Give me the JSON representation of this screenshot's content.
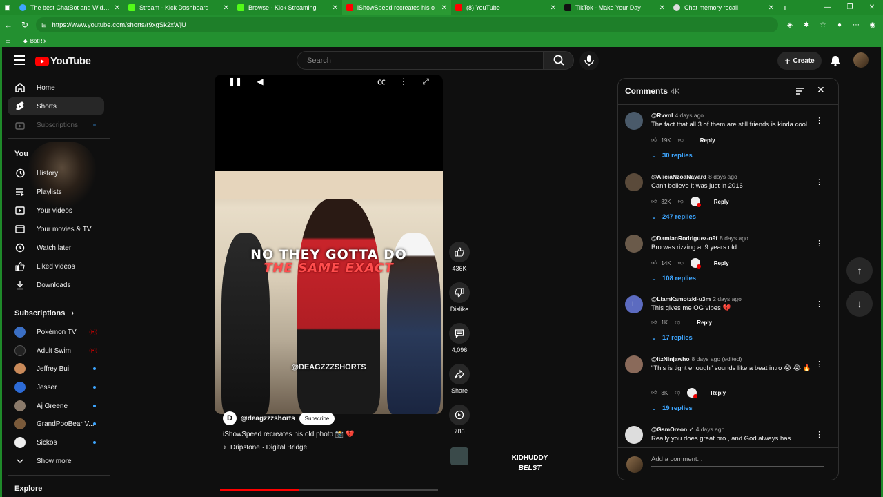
{
  "browser": {
    "tabs": [
      {
        "title": "The best ChatBot and Widgets fo",
        "color": "#3ea6ff"
      },
      {
        "title": "Stream - Kick Dashboard",
        "color": "#53fc18"
      },
      {
        "title": "Browse - Kick Streaming",
        "color": "#53fc18"
      },
      {
        "title": "iShowSpeed recreates his o",
        "color": "#ff0000"
      },
      {
        "title": "(8) YouTube",
        "color": "#ff0000"
      },
      {
        "title": "TikTok - Make Your Day",
        "color": "#111111"
      },
      {
        "title": "Chat memory recall",
        "color": "#dddddd"
      }
    ],
    "url": "https://www.youtube.com/shorts/r9xgSk2xWjU",
    "bookmark": "BotRix"
  },
  "masthead": {
    "logo": "YouTube",
    "search_placeholder": "Search",
    "create_label": "Create"
  },
  "sidebar": {
    "items": [
      {
        "label": "Home",
        "icon": "home-icon"
      },
      {
        "label": "Shorts",
        "icon": "shorts-icon"
      },
      {
        "label": "Subscriptions",
        "icon": "subscriptions-icon"
      }
    ],
    "you_title": "You",
    "you_items": [
      {
        "label": "History",
        "icon": "history-icon"
      },
      {
        "label": "Playlists",
        "icon": "playlists-icon"
      },
      {
        "label": "Your videos",
        "icon": "your-videos-icon"
      },
      {
        "label": "Your movies & TV",
        "icon": "movies-icon"
      },
      {
        "label": "Watch later",
        "icon": "watch-later-icon"
      },
      {
        "label": "Liked videos",
        "icon": "liked-icon"
      },
      {
        "label": "Downloads",
        "icon": "download-icon"
      }
    ],
    "subscriptions_title": "Subscriptions",
    "subscriptions": [
      {
        "label": "Pokémon TV",
        "color": "#3b6fc4",
        "live": true
      },
      {
        "label": "Adult Swim",
        "color": "#111111",
        "live": true
      },
      {
        "label": "Jeffrey Bui",
        "color": "#c98a5a",
        "live": false
      },
      {
        "label": "Jesser",
        "color": "#2d6bd6",
        "live": false
      },
      {
        "label": "Aj Greene",
        "color": "#8a7a6a",
        "live": false
      },
      {
        "label": "GrandPooBear V...",
        "color": "#7a5a3a",
        "live": false
      },
      {
        "label": "Sickos",
        "color": "#eeeeee",
        "live": false
      }
    ],
    "show_more": "Show more",
    "explore_title": "Explore"
  },
  "short": {
    "caption_line1": "NO THEY GOTTA DO",
    "caption_line2": "THE SAME EXACT",
    "watermark": "@DEAGZZZSHORTS",
    "channel_initial": "D",
    "channel": "@deagzzzshorts",
    "subscribe_label": "Subscribe",
    "title": "iShowSpeed recreates his old photo 📸 💔",
    "sound": "Dripstone · Digital Bridge",
    "progress": 0.36
  },
  "actions": {
    "likes": "436K",
    "dislike_label": "Dislike",
    "comments": "4,096",
    "share_label": "Share",
    "remix": "786"
  },
  "overlay": {
    "line1": "KIDHUDDY",
    "line2": "BELST"
  },
  "comments": {
    "title": "Comments",
    "count": "4K",
    "items": [
      {
        "author": "@Rvvnl",
        "ago": "4 days ago",
        "text": "The fact that all 3 of them are still friends is kinda cool",
        "likes": "19K",
        "creator_heart": false,
        "replies": "30 replies",
        "avatar_color": "#4a5a6a"
      },
      {
        "author": "@AliciaNzoaNayard",
        "ago": "8 days ago",
        "text": "Can't believe it was just in 2016",
        "likes": "32K",
        "creator_heart": true,
        "replies": "247 replies",
        "avatar_color": "#5a4a3a"
      },
      {
        "author": "@DamianRodriguez-o9f",
        "ago": "8 days ago",
        "text": "Bro was rizzing at 9 years old",
        "likes": "14K",
        "creator_heart": true,
        "replies": "108 replies",
        "avatar_color": "#6a5a4a"
      },
      {
        "author": "@LiamKamotzki-u3m",
        "ago": "2 days ago",
        "text": "This gives me OG vibes 💔",
        "likes": "1K",
        "creator_heart": false,
        "replies": "17 replies",
        "avatar_color": "#5c6bc0",
        "initial": "L"
      },
      {
        "author": "@ItzNinjawho",
        "ago": "8 days ago (edited)",
        "text": "\"This is tight enough\" sounds like a beat intro 😭 😭 🔥",
        "likes": "3K",
        "creator_heart": true,
        "replies": "19 replies",
        "avatar_color": "#8a6a5a"
      },
      {
        "author": "@GsmOreon ✓",
        "ago": "4 days ago",
        "text": "Really you does great bro , and God always has",
        "avatar_color": "#dddddd"
      }
    ],
    "reply_label": "Reply",
    "add_placeholder": "Add a comment..."
  }
}
